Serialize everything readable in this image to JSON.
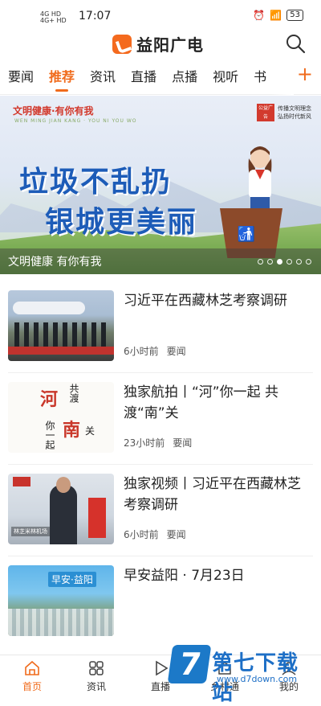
{
  "status_bar": {
    "network_top": "4G HD",
    "network_bottom": "4G+ HD",
    "time": "17:07",
    "battery": "53"
  },
  "header": {
    "app_name": "益阳广电"
  },
  "tabs": [
    "要闻",
    "推荐",
    "资讯",
    "直播",
    "点播",
    "视听",
    "书"
  ],
  "active_tab_index": 1,
  "banner": {
    "brand": "文明健康·有你有我",
    "brand_sub": "WEN MING JIAN KANG · YOU NI YOU WO",
    "seal": "公益广告",
    "slogan_right_1": "传播文明理念",
    "slogan_right_2": "弘扬时代新风",
    "headline_1": "垃圾不乱扔",
    "headline_2": "银城更美丽",
    "caption": "文明健康 有你有我",
    "slide_count": 6,
    "active_slide": 2
  },
  "news": [
    {
      "title": "习近平在西藏林芝考察调研",
      "time": "6小时前",
      "tag": "要闻"
    },
    {
      "title": "独家航拍丨“河”你一起 共渡“南”关",
      "time": "23小时前",
      "tag": "要闻",
      "thumb_text": [
        "河",
        "共渡",
        "你一起",
        "南",
        "关"
      ]
    },
    {
      "title": "独家视频丨习近平在西藏林芝考察调研",
      "time": "6小时前",
      "tag": "要闻",
      "thumb_sign": "林芝米林机场"
    },
    {
      "title": "早安益阳 · 7月23日",
      "time": "",
      "tag": "",
      "thumb_title": "早安·益阳"
    }
  ],
  "tabbar": [
    "首页",
    "资讯",
    "直播",
    "乡村通",
    "我的"
  ],
  "active_tabbar_index": 0,
  "watermark": {
    "name": "第七下载站",
    "url": "www.d7down.com"
  },
  "colors": {
    "accent": "#f06b1c",
    "banner_headline": "#1d5cb8",
    "watermark": "#1d6fc6"
  }
}
